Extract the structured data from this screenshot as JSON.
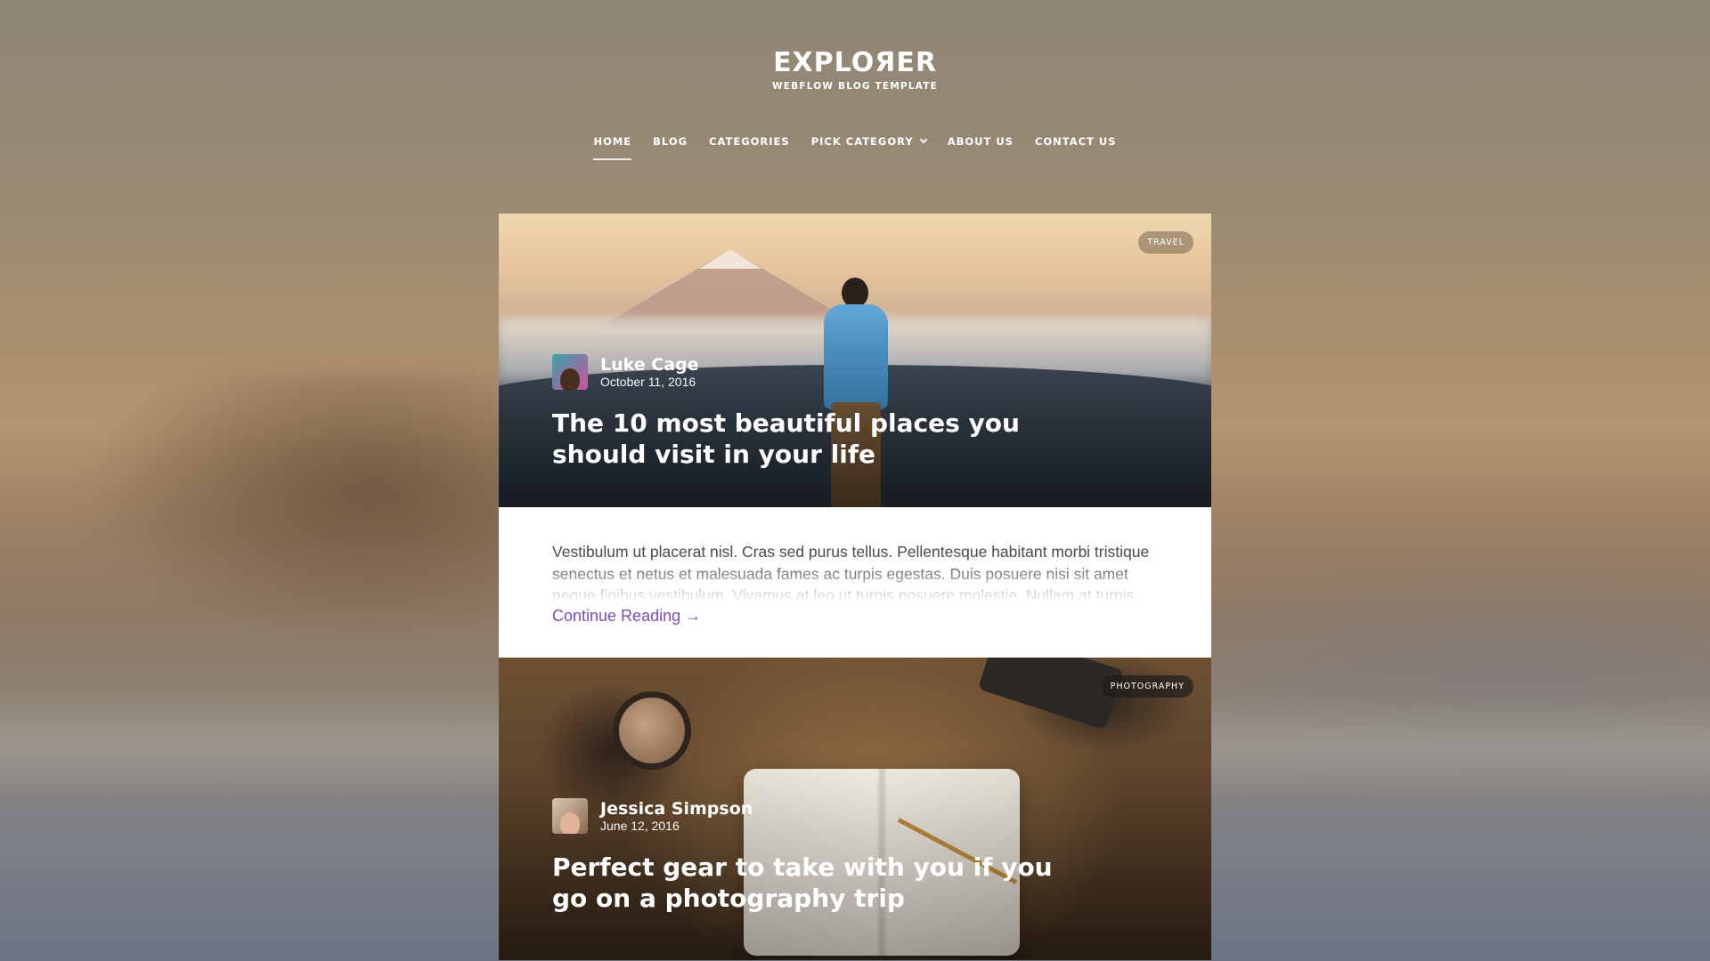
{
  "site": {
    "logo_title": "EXPLOЯER",
    "logo_subtitle": "WEBFLOW BLOG TEMPLATE"
  },
  "nav": {
    "items": [
      {
        "label": "HOME",
        "active": true
      },
      {
        "label": "BLOG"
      },
      {
        "label": "CATEGORIES"
      },
      {
        "label": "PICK CATEGORY",
        "dropdown": true
      },
      {
        "label": "ABOUT US"
      },
      {
        "label": "CONTACT US"
      }
    ]
  },
  "posts": [
    {
      "category": "TRAVEL",
      "author": "Luke Cage",
      "date": "October 11, 2016",
      "title": "The 10 most beautiful places you should visit in your life",
      "excerpt": "Vestibulum ut placerat nisl. Cras sed purus tellus. Pellentesque habitant morbi tristique senectus et netus et malesuada fames ac turpis egestas. Duis posuere nisi sit amet neque finibus vestibulum. Vivamus at leo ut turpis posuere molestie. Nullam at turpis nec metus",
      "read_more": "Continue Reading →"
    },
    {
      "category": "PHOTOGRAPHY",
      "author": "Jessica Simpson",
      "date": "June 12, 2016",
      "title": "Perfect gear to take with you if you go on a photography trip"
    }
  ],
  "colors": {
    "link": "#7a4db8",
    "text": "#4a4a4a"
  }
}
